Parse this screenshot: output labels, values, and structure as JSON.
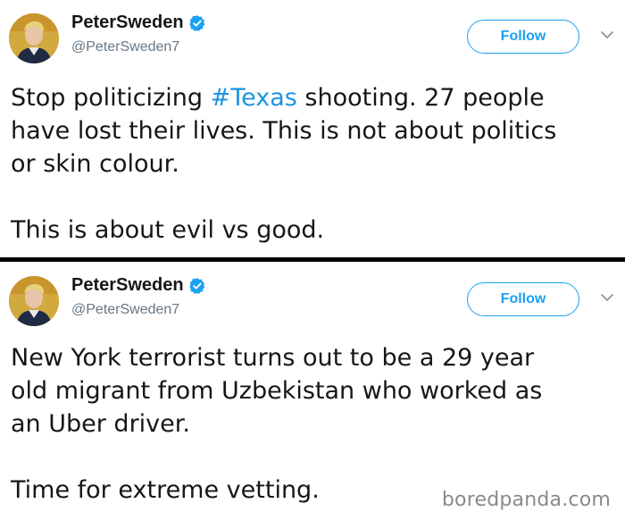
{
  "tweets": [
    {
      "user": {
        "display_name": "PeterSweden",
        "handle": "@PeterSweden7"
      },
      "follow_label": "Follow",
      "text": {
        "line1_before": "Stop politicizing ",
        "hashtag": "#Texas",
        "line1_after": " shooting. 27 people",
        "line2": "have lost their lives. This is not about politics",
        "line3": "or skin colour.",
        "line4": "This is about evil vs good."
      }
    },
    {
      "user": {
        "display_name": "PeterSweden",
        "handle": "@PeterSweden7"
      },
      "follow_label": "Follow",
      "text": {
        "line1": "New York terrorist turns out to be a 29 year",
        "line2": "old migrant from Uzbekistan who worked as",
        "line3": "an Uber driver.",
        "line4": "Time for extreme vetting."
      }
    }
  ],
  "watermark": "boredpanda.com",
  "colors": {
    "accent": "#1da1f2",
    "hashtag": "#1b95e0",
    "handle": "#657786",
    "divider": "#000000"
  },
  "icons": [
    "verified-icon",
    "chevron-down-icon",
    "avatar"
  ]
}
